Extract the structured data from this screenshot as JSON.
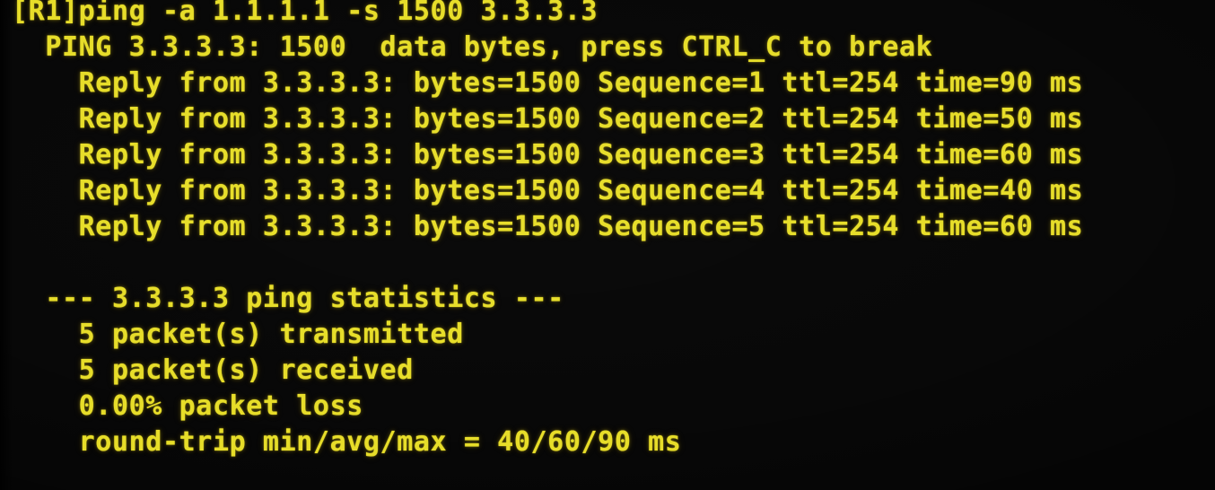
{
  "terminal": {
    "background_color": "#050505",
    "text_color": "#e7dd27",
    "prompt": "[R1]",
    "command": "ping -a 1.1.1.1 -s 1500 3.3.3.3",
    "prompt_line": "[R1]ping -a 1.1.1.1 -s 1500 3.3.3.3",
    "ping_header": "  PING 3.3.3.3: 1500  data bytes, press CTRL_C to break",
    "replies": [
      "    Reply from 3.3.3.3: bytes=1500 Sequence=1 ttl=254 time=90 ms",
      "    Reply from 3.3.3.3: bytes=1500 Sequence=2 ttl=254 time=50 ms",
      "    Reply from 3.3.3.3: bytes=1500 Sequence=3 ttl=254 time=60 ms",
      "    Reply from 3.3.3.3: bytes=1500 Sequence=4 ttl=254 time=40 ms",
      "    Reply from 3.3.3.3: bytes=1500 Sequence=5 ttl=254 time=60 ms"
    ],
    "blank_line": " ",
    "statistics_header": "  --- 3.3.3.3 ping statistics ---",
    "statistics": [
      "    5 packet(s) transmitted",
      "    5 packet(s) received",
      "    0.00% packet loss",
      "    round-trip min/avg/max = 40/60/90 ms"
    ],
    "parsed": {
      "target_host": "3.3.3.3",
      "source_address": "1.1.1.1",
      "packet_size": "1500",
      "data_bytes": "1500",
      "break_key": "CTRL_C",
      "reply_entries": [
        {
          "host": "3.3.3.3",
          "bytes": "1500",
          "sequence": "1",
          "ttl": "254",
          "time": "90",
          "unit": "ms"
        },
        {
          "host": "3.3.3.3",
          "bytes": "1500",
          "sequence": "2",
          "ttl": "254",
          "time": "50",
          "unit": "ms"
        },
        {
          "host": "3.3.3.3",
          "bytes": "1500",
          "sequence": "3",
          "ttl": "254",
          "time": "60",
          "unit": "ms"
        },
        {
          "host": "3.3.3.3",
          "bytes": "1500",
          "sequence": "4",
          "ttl": "254",
          "time": "40",
          "unit": "ms"
        },
        {
          "host": "3.3.3.3",
          "bytes": "1500",
          "sequence": "5",
          "ttl": "254",
          "time": "60",
          "unit": "ms"
        }
      ],
      "packets_transmitted": "5",
      "packets_received": "5",
      "packet_loss": "0.00%",
      "rtt_min": "40",
      "rtt_avg": "60",
      "rtt_max": "90",
      "rtt_unit": "ms"
    }
  }
}
